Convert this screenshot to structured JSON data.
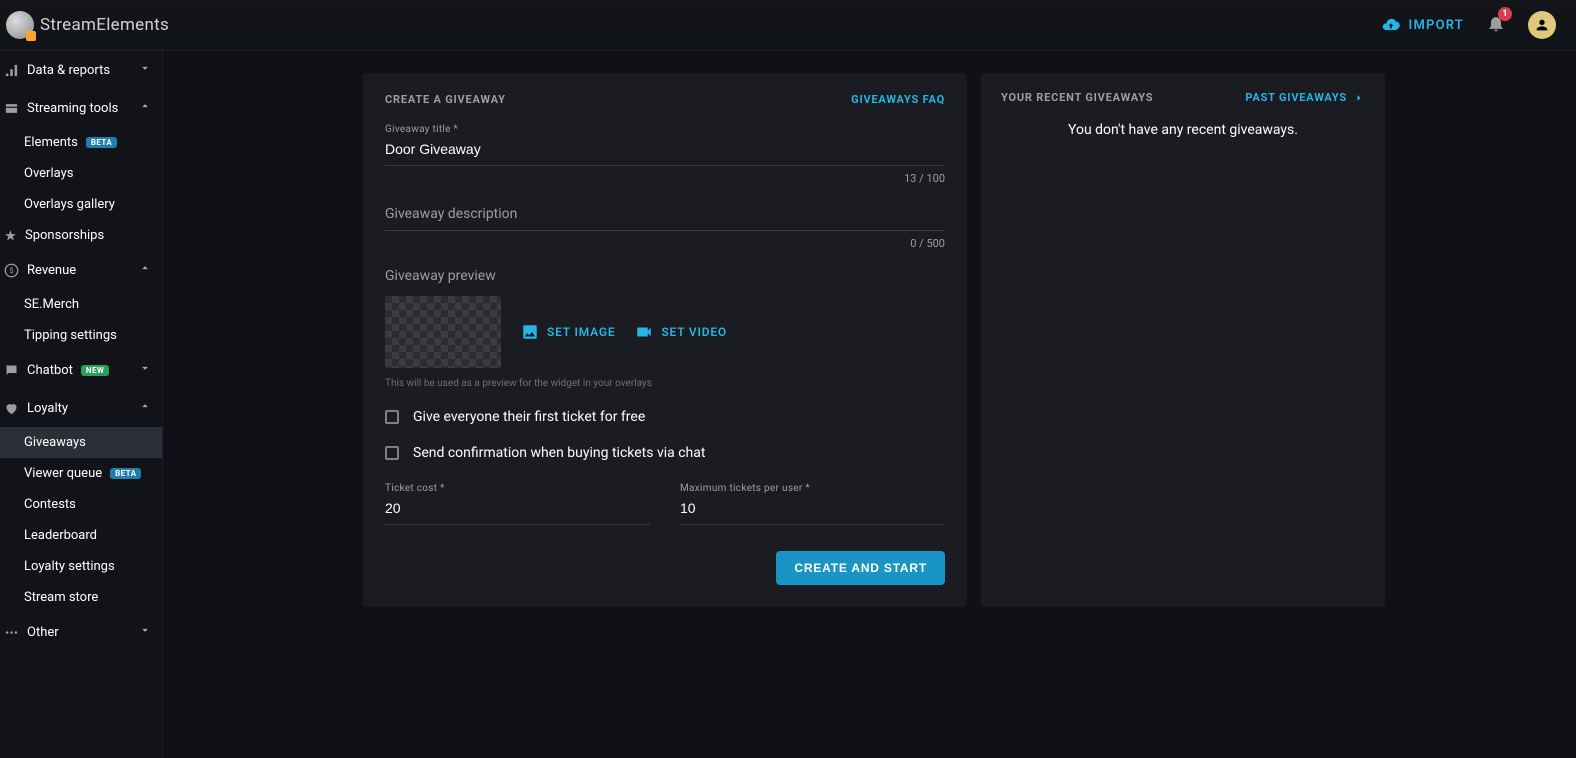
{
  "topbar": {
    "brand": "StreamElements",
    "import_label": "IMPORT",
    "notification_count": "1"
  },
  "sidebar": {
    "groups": [
      {
        "label": "Data & reports",
        "icon": "bar-chart-icon",
        "expanded": false,
        "children": []
      },
      {
        "label": "Streaming tools",
        "icon": "tools-icon",
        "expanded": true,
        "children": [
          {
            "label": "Elements",
            "badge": "BETA",
            "badge_type": "beta"
          },
          {
            "label": "Overlays"
          },
          {
            "label": "Overlays gallery"
          },
          {
            "label": "Sponsorships",
            "leading_icon": "star-icon"
          }
        ]
      },
      {
        "label": "Revenue",
        "icon": "dollar-icon",
        "expanded": true,
        "children": [
          {
            "label": "SE.Merch"
          },
          {
            "label": "Tipping settings"
          }
        ]
      },
      {
        "label": "Chatbot",
        "icon": "chat-icon",
        "expanded": false,
        "badge": "NEW",
        "badge_type": "new",
        "children": []
      },
      {
        "label": "Loyalty",
        "icon": "heart-icon",
        "expanded": true,
        "children": [
          {
            "label": "Giveaways",
            "active": true
          },
          {
            "label": "Viewer queue",
            "badge": "BETA",
            "badge_type": "beta"
          },
          {
            "label": "Contests"
          },
          {
            "label": "Leaderboard"
          },
          {
            "label": "Loyalty settings"
          },
          {
            "label": "Stream store"
          }
        ]
      },
      {
        "label": "Other",
        "icon": "dots-icon",
        "expanded": false,
        "children": []
      }
    ]
  },
  "form": {
    "header": "CREATE A GIVEAWAY",
    "faq_link": "GIVEAWAYS FAQ",
    "title_label": "Giveaway title *",
    "title_value": "Door Giveaway",
    "title_counter": "13 / 100",
    "description_label": "Giveaway description",
    "description_counter": "0 / 500",
    "preview_label": "Giveaway preview",
    "set_image_label": "SET IMAGE",
    "set_video_label": "SET VIDEO",
    "preview_hint": "This will be used as a preview for the widget in your overlays",
    "checkbox_first_ticket": "Give everyone their first ticket for free",
    "checkbox_confirm": "Send confirmation when buying tickets via chat",
    "ticket_cost_label": "Ticket cost *",
    "ticket_cost_value": "20",
    "max_tickets_label": "Maximum tickets per user *",
    "max_tickets_value": "10",
    "submit_label": "CREATE AND START"
  },
  "recent": {
    "header": "YOUR RECENT GIVEAWAYS",
    "past_link": "PAST GIVEAWAYS",
    "empty": "You don't have any recent giveaways."
  }
}
